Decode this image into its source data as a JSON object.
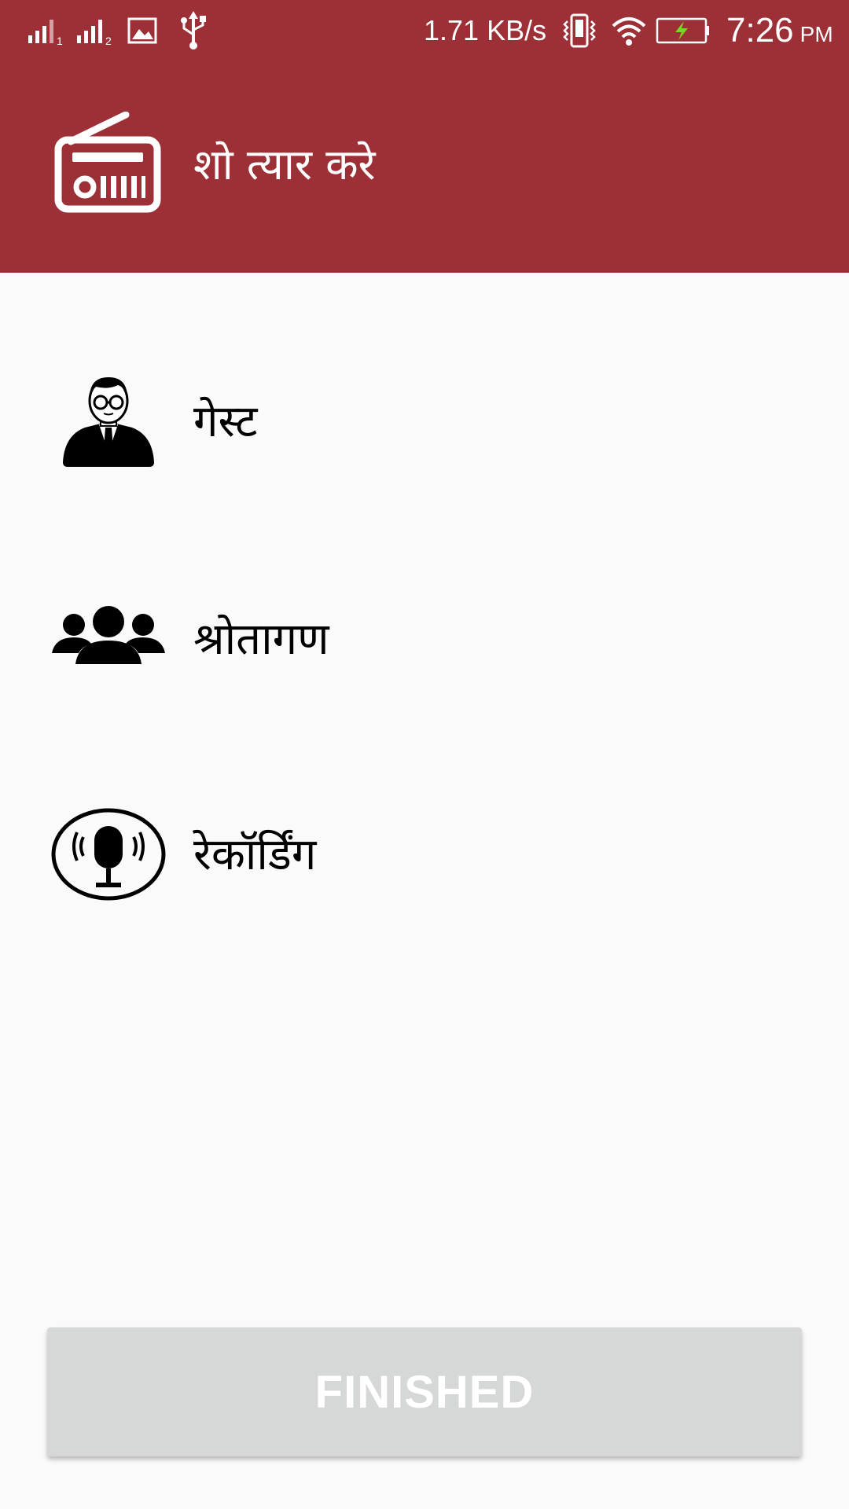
{
  "status_bar": {
    "network_speed": "1.71 KB/s",
    "time": "7:26",
    "ampm": "PM",
    "icons": [
      "signal-sim1-icon",
      "signal-sim2-icon",
      "gallery-notification-icon",
      "usb-icon",
      "vibrate-icon",
      "wifi-icon",
      "battery-charging-icon"
    ]
  },
  "toolbar": {
    "title": "शो त्यार करे",
    "icon": "radio-icon"
  },
  "menu": {
    "items": [
      {
        "label": "गेस्ट",
        "icon": "guest-person-icon"
      },
      {
        "label": "श्रोतागण",
        "icon": "audience-group-icon"
      },
      {
        "label": "रेकॉर्डिंग",
        "icon": "microphone-recording-icon"
      }
    ]
  },
  "finish_button": {
    "label": "FINISHED"
  },
  "colors": {
    "app_bar": "#9c3036",
    "background": "#fafafa",
    "button_disabled": "#d6d7d7",
    "battery_bolt": "#7ed321"
  }
}
